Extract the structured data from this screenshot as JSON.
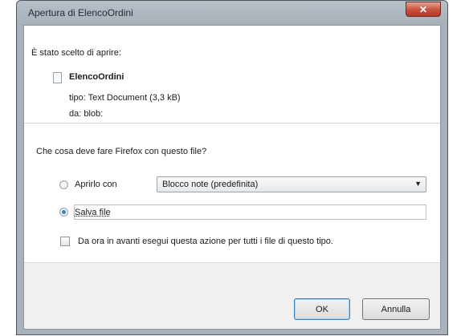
{
  "window": {
    "title": "Apertura di ElencoOrdini",
    "close_icon": "close-icon"
  },
  "dialog": {
    "intro": "È stato scelto di aprire:",
    "file": {
      "icon": "document-icon",
      "name": "ElencoOrdini",
      "type_line": "tipo: Text Document (3,3 kB)",
      "from_line": "da: blob:"
    },
    "question": "Che cosa deve fare Firefox con questo file?",
    "options": {
      "open_with": {
        "label": "Aprirlo con",
        "selected": false,
        "app_value": "Blocco note (predefinita)"
      },
      "save_file": {
        "label": "Salva file",
        "selected": true
      }
    },
    "remember_checkbox": {
      "label": "Da ora in avanti esegui questa azione per tutti i file di questo tipo.",
      "checked": false
    },
    "buttons": {
      "ok": "OK",
      "cancel": "Annulla"
    }
  },
  "colors": {
    "frame": "#a9b2ba",
    "close_button": "#c8503d",
    "radio_selected": "#3d7bd6",
    "footer": "#f0f0f0"
  }
}
